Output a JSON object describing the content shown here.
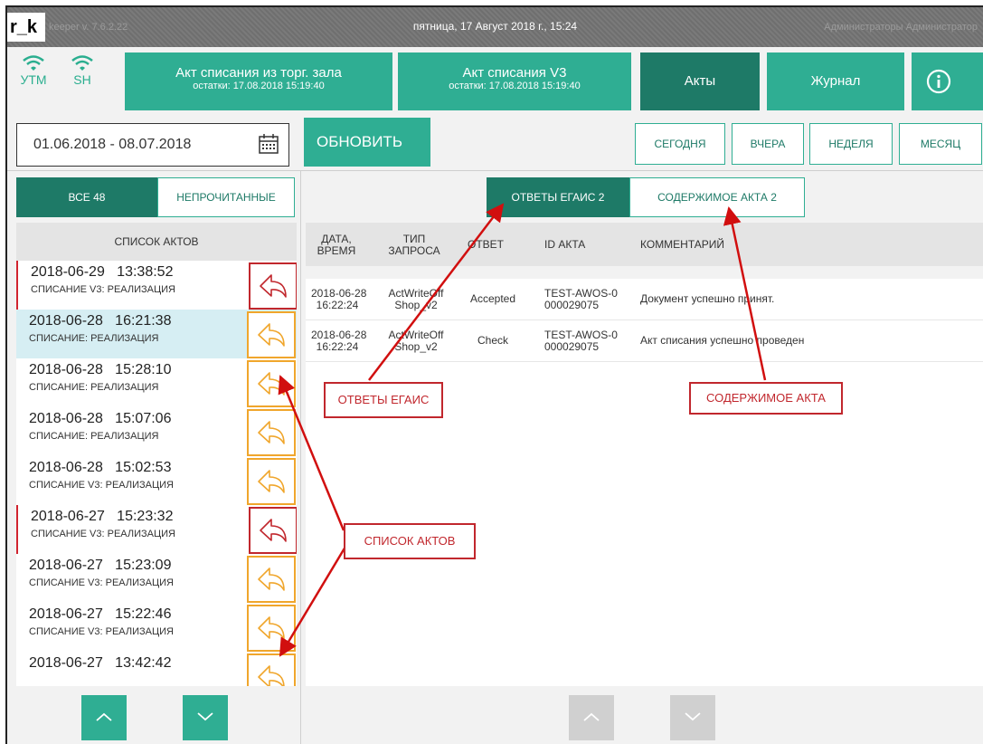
{
  "titlebar": {
    "logo": "r_k",
    "version": "keeper v. 7.6.2.22",
    "datetime": "пятница, 17 Август 2018 г., 15:24",
    "user": "Администраторы Администратор"
  },
  "status": {
    "utm": "УТМ",
    "sh": "SH"
  },
  "header_buttons": [
    {
      "title": "Акт списания из торг. зала",
      "subtitle": "остатки: 17.08.2018 15:19:40"
    },
    {
      "title": "Акт списания V3",
      "subtitle": "остатки: 17.08.2018 15:19:40"
    },
    {
      "title": "Акты"
    },
    {
      "title": "Журнал"
    }
  ],
  "date_range": "01.06.2018 - 08.07.2018",
  "refresh_label": "ОБНОВИТЬ",
  "periods": [
    "СЕГОДНЯ",
    "ВЧЕРА",
    "НЕДЕЛЯ",
    "МЕСЯЦ"
  ],
  "left": {
    "filter_all": "ВСЕ  48",
    "filter_unread": "НЕПРОЧИТАННЫЕ",
    "list_header": "СПИСОК АКТОВ",
    "acts": [
      {
        "datetime": "2018-06-29   13:38:52",
        "type": "СПИСАНИЕ V3: РЕАЛИЗАЦИЯ",
        "reply_state": "red",
        "marked": true,
        "selected": false
      },
      {
        "datetime": "2018-06-28   16:21:38",
        "type": "СПИСАНИЕ: РЕАЛИЗАЦИЯ",
        "reply_state": "orange",
        "marked": false,
        "selected": true
      },
      {
        "datetime": "2018-06-28   15:28:10",
        "type": "СПИСАНИЕ: РЕАЛИЗАЦИЯ",
        "reply_state": "orange",
        "marked": false,
        "selected": false
      },
      {
        "datetime": "2018-06-28   15:07:06",
        "type": "СПИСАНИЕ: РЕАЛИЗАЦИЯ",
        "reply_state": "orange",
        "marked": false,
        "selected": false
      },
      {
        "datetime": "2018-06-28   15:02:53",
        "type": "СПИСАНИЕ V3: РЕАЛИЗАЦИЯ",
        "reply_state": "orange",
        "marked": false,
        "selected": false
      },
      {
        "datetime": "2018-06-27   15:23:32",
        "type": "СПИСАНИЕ V3: РЕАЛИЗАЦИЯ",
        "reply_state": "red",
        "marked": true,
        "selected": false
      },
      {
        "datetime": "2018-06-27   15:23:09",
        "type": "СПИСАНИЕ V3: РЕАЛИЗАЦИЯ",
        "reply_state": "orange",
        "marked": false,
        "selected": false
      },
      {
        "datetime": "2018-06-27   15:22:46",
        "type": "СПИСАНИЕ V3: РЕАЛИЗАЦИЯ",
        "reply_state": "orange",
        "marked": false,
        "selected": false
      },
      {
        "datetime": "2018-06-27   13:42:42",
        "type": "",
        "reply_state": "orange",
        "marked": false,
        "selected": false
      }
    ]
  },
  "right": {
    "tab_egais": "ОТВЕТЫ ЕГАИС  2",
    "tab_content": "СОДЕРЖИМОЕ АКТА  2",
    "columns": [
      "ДАТА,\nВРЕМЯ",
      "ТИП\nЗАПРОСА",
      "ОТВЕТ",
      "ID АКТА",
      "КОММЕНТАРИЙ"
    ],
    "rows": [
      {
        "datetime": "2018-06-28\n16:22:24",
        "request": "ActWriteOff\nShop_v2",
        "answer": "Accepted",
        "act_id": "TEST-AWOS-0\n000029075",
        "comment": "Документ успешно принят."
      },
      {
        "datetime": "2018-06-28\n16:22:24",
        "request": "ActWriteOff\nShop_v2",
        "answer": "Check",
        "act_id": "TEST-AWOS-0\n000029075",
        "comment": "Акт списания успешно проведен"
      }
    ]
  },
  "annotations": {
    "egais": "ОТВЕТЫ ЕГАИС",
    "content": "СОДЕРЖИМОЕ АКТА",
    "list": "СПИСОК АКТОВ"
  },
  "colors": {
    "teal": "#2fae93",
    "teal_dark": "#1e7a67",
    "selected_row": "#d6eef3",
    "reply_orange": "#f0a62c",
    "reply_red": "#c1272d",
    "annotation_red": "#d10f0f"
  },
  "icons": {
    "wifi": "wifi-icon",
    "calendar": "calendar-icon",
    "info": "info-icon",
    "reply": "reply-arrow-icon",
    "up": "chevron-up-icon",
    "down": "chevron-down-icon"
  }
}
